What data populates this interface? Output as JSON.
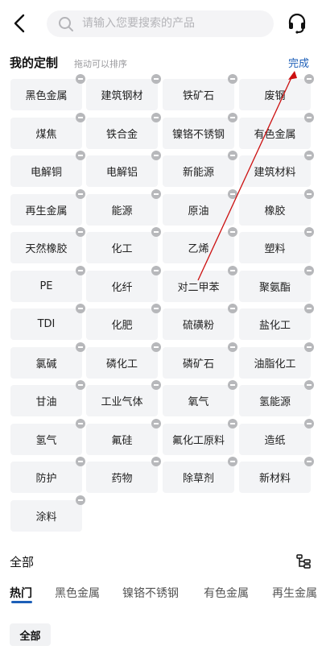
{
  "header": {
    "search_placeholder": "请输入您要搜索的产品"
  },
  "custom_section": {
    "title": "我的定制",
    "hint": "拖动可以排序",
    "done_label": "完成",
    "items": [
      "黑色金属",
      "建筑钢材",
      "铁矿石",
      "废钢",
      "煤焦",
      "铁合金",
      "镍铬不锈钢",
      "有色金属",
      "电解铜",
      "电解铝",
      "新能源",
      "建筑材料",
      "再生金属",
      "能源",
      "原油",
      "橡胶",
      "天然橡胶",
      "化工",
      "乙烯",
      "塑料",
      "PE",
      "化纤",
      "对二甲苯",
      "聚氨酯",
      "TDI",
      "化肥",
      "硫磺粉",
      "盐化工",
      "氯碱",
      "磷化工",
      "磷矿石",
      "油脂化工",
      "甘油",
      "工业气体",
      "氧气",
      "氢能源",
      "氢气",
      "氟硅",
      "氟化工原料",
      "造纸",
      "防护",
      "药物",
      "除草剂",
      "新材料",
      "涂料"
    ]
  },
  "all_section": {
    "title": "全部",
    "tabs": [
      "热门",
      "黑色金属",
      "镍铬不锈钢",
      "有色金属",
      "再生金属"
    ],
    "active_tab": 0,
    "sub_chip": "全部"
  },
  "colors": {
    "accent": "#1d5fb8",
    "annotation_arrow": "#cc1010"
  },
  "icons": {
    "back": "chevron-left-icon",
    "search": "search-icon",
    "service": "headset-icon",
    "remove": "minus-circle-icon",
    "tree": "tree-structure-icon"
  }
}
